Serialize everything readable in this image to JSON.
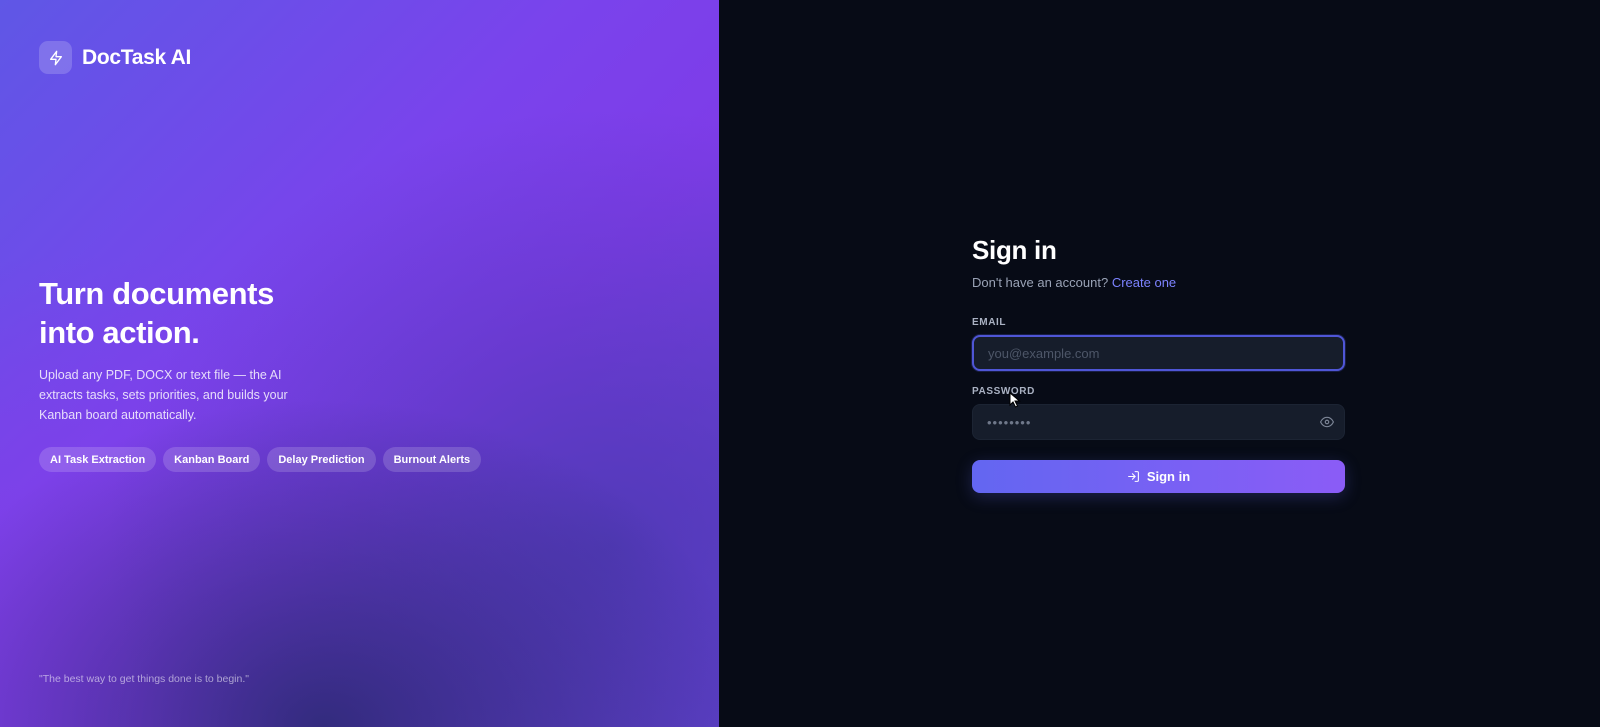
{
  "brand": {
    "name": "DocTask AI",
    "icon": "lightning-bolt-icon"
  },
  "hero": {
    "headline_line1": "Turn documents",
    "headline_line2": "into action.",
    "description": "Upload any PDF, DOCX or text file — the AI extracts tasks, sets priorities, and builds your Kanban board automatically.",
    "features": [
      "AI Task Extraction",
      "Kanban Board",
      "Delay Prediction",
      "Burnout Alerts"
    ],
    "quote": "\"The best way to get things done is to begin.\""
  },
  "signin": {
    "title": "Sign in",
    "prompt": "Don't have an account?",
    "create_link": "Create one",
    "email_label": "EMAIL",
    "email_placeholder": "you@example.com",
    "email_value": "",
    "password_label": "PASSWORD",
    "password_value": "••••••••",
    "submit_label": "Sign in"
  },
  "colors": {
    "accent": "#6366f1",
    "accent_end": "#8b5cf6",
    "link": "#7c83ff",
    "background": "#070b16",
    "input_background": "#161d2b"
  }
}
